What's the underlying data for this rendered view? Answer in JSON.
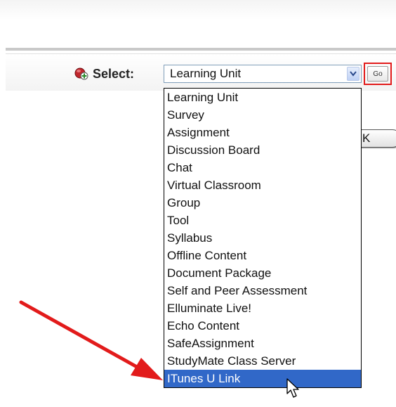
{
  "toolbar": {
    "select_label": "Select:",
    "select_value": "Learning Unit",
    "go_label": "Go"
  },
  "ok_button": {
    "label": "K"
  },
  "dropdown": {
    "options": [
      "Learning Unit",
      "Survey",
      "Assignment",
      "Discussion Board",
      "Chat",
      "Virtual Classroom",
      "Group",
      "Tool",
      "Syllabus",
      "Offline Content",
      "Document Package",
      "Self and Peer Assessment",
      "Elluminate Live!",
      "Echo Content",
      "SafeAssignment",
      "StudyMate Class Server",
      "ITunes U Link"
    ],
    "highlighted": "ITunes U Link"
  },
  "colors": {
    "highlight": "#3168c8",
    "annotation": "#e21b1b"
  },
  "icons": {
    "add": "add-content-icon",
    "dropdown_arrow": "chevron-down-icon",
    "cursor": "mouse-pointer-icon",
    "annotation_arrow": "red-arrow-annotation"
  }
}
